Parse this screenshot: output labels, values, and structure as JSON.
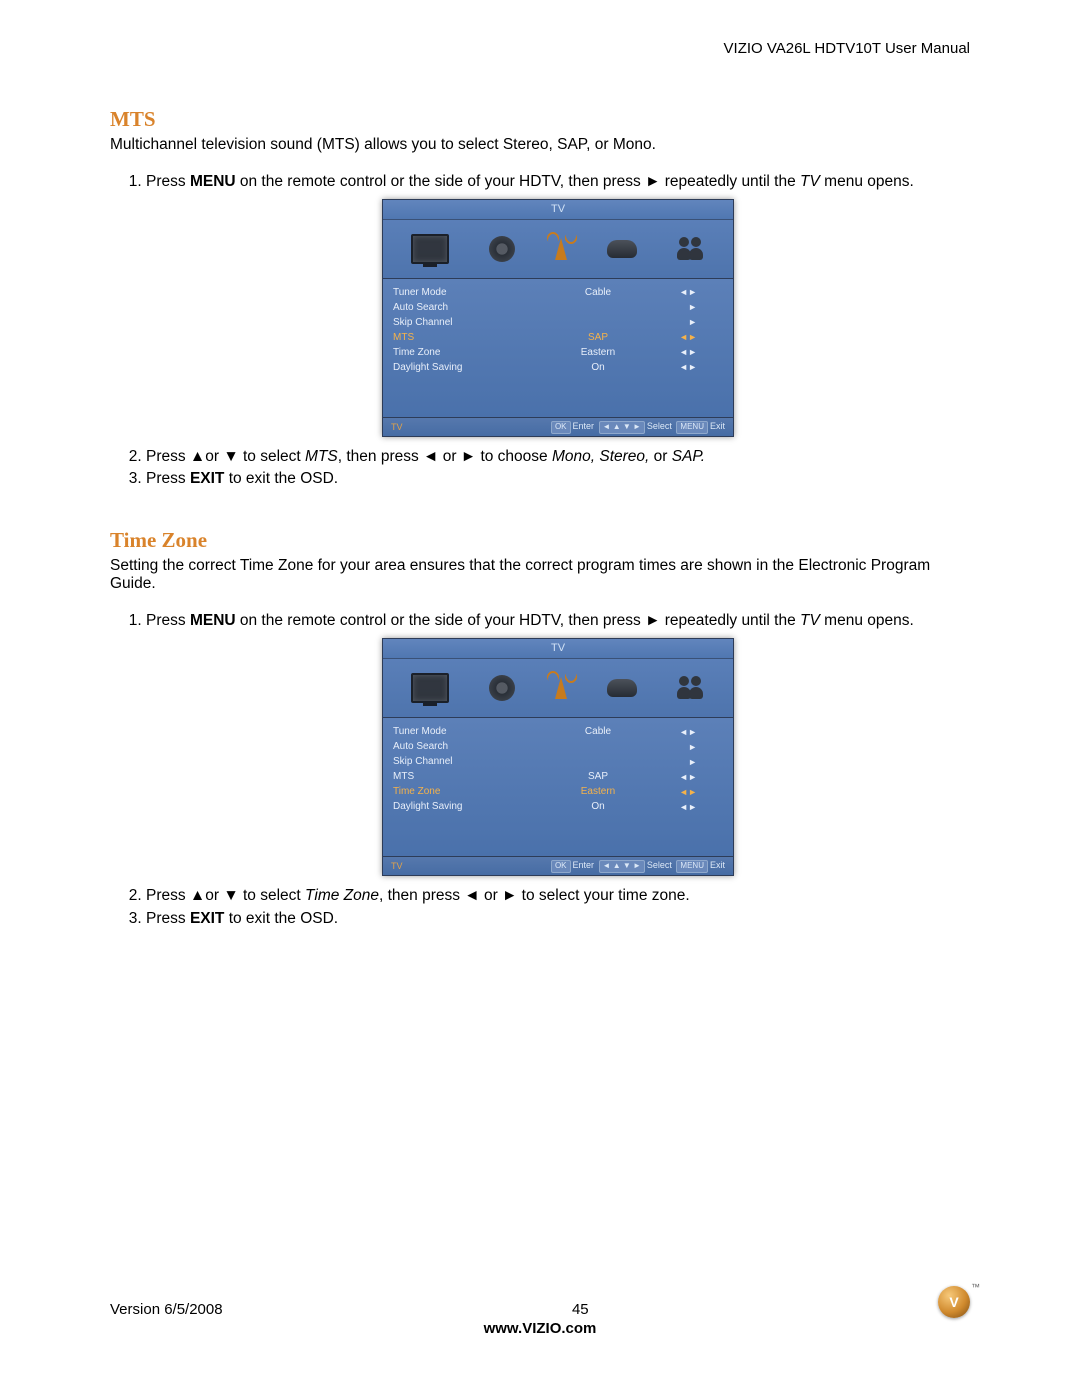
{
  "header": {
    "title": "VIZIO VA26L HDTV10T User Manual"
  },
  "sections": [
    {
      "heading": "MTS",
      "intro": "Multichannel television sound (MTS) allows you to select Stereo, SAP, or Mono.",
      "steps": [
        {
          "pre": "Press ",
          "bold": "MENU",
          "mid": " on the remote control or the side of your HDTV, then press ► repeatedly until the ",
          "ital": "TV",
          "post": " menu opens."
        },
        {
          "text_html": "Press ▲or ▼ to select <em>MTS</em>, then press ◄ or ► to choose <em>Mono, Stereo,</em> or <em>SAP.</em>"
        },
        {
          "text_html": "Press <strong>EXIT</strong> to exit the OSD."
        }
      ],
      "osd": {
        "title": "TV",
        "highlight": "MTS",
        "rows": [
          {
            "label": "Tuner Mode",
            "value": "Cable",
            "ind": "◄►"
          },
          {
            "label": "Auto Search",
            "value": "",
            "ind": "►"
          },
          {
            "label": "Skip Channel",
            "value": "",
            "ind": "►"
          },
          {
            "label": "MTS",
            "value": "SAP",
            "ind": "◄►"
          },
          {
            "label": "Time Zone",
            "value": "Eastern",
            "ind": "◄►"
          },
          {
            "label": "Daylight Saving",
            "value": "On",
            "ind": "◄►"
          }
        ],
        "footer": {
          "cat": "TV",
          "ok": "OK",
          "enter": "Enter",
          "sel_keys": "◄ ▲ ▼ ►",
          "select": "Select",
          "menu": "MENU",
          "exit": "Exit"
        }
      }
    },
    {
      "heading": "Time Zone",
      "intro": "Setting the correct Time Zone for your area ensures that the correct program times are shown in the Electronic Program Guide.",
      "steps": [
        {
          "pre": "Press ",
          "bold": "MENU",
          "mid": " on the remote control or the side of your HDTV, then press ► repeatedly until the ",
          "ital": "TV",
          "post": " menu opens."
        },
        {
          "text_html": "Press ▲or ▼ to select <em>Time Zone</em>, then press ◄ or ► to select your time zone."
        },
        {
          "text_html": "Press <strong>EXIT</strong> to exit the OSD."
        }
      ],
      "osd": {
        "title": "TV",
        "highlight": "Time Zone",
        "rows": [
          {
            "label": "Tuner Mode",
            "value": "Cable",
            "ind": "◄►"
          },
          {
            "label": "Auto Search",
            "value": "",
            "ind": "►"
          },
          {
            "label": "Skip Channel",
            "value": "",
            "ind": "►"
          },
          {
            "label": "MTS",
            "value": "SAP",
            "ind": "◄►"
          },
          {
            "label": "Time Zone",
            "value": "Eastern",
            "ind": "◄►"
          },
          {
            "label": "Daylight Saving",
            "value": "On",
            "ind": "◄►"
          }
        ],
        "footer": {
          "cat": "TV",
          "ok": "OK",
          "enter": "Enter",
          "sel_keys": "◄ ▲ ▼ ►",
          "select": "Select",
          "menu": "MENU",
          "exit": "Exit"
        }
      }
    }
  ],
  "footer": {
    "version": "Version 6/5/2008",
    "page": "45",
    "url": "www.VIZIO.com",
    "logo_letter": "V"
  }
}
